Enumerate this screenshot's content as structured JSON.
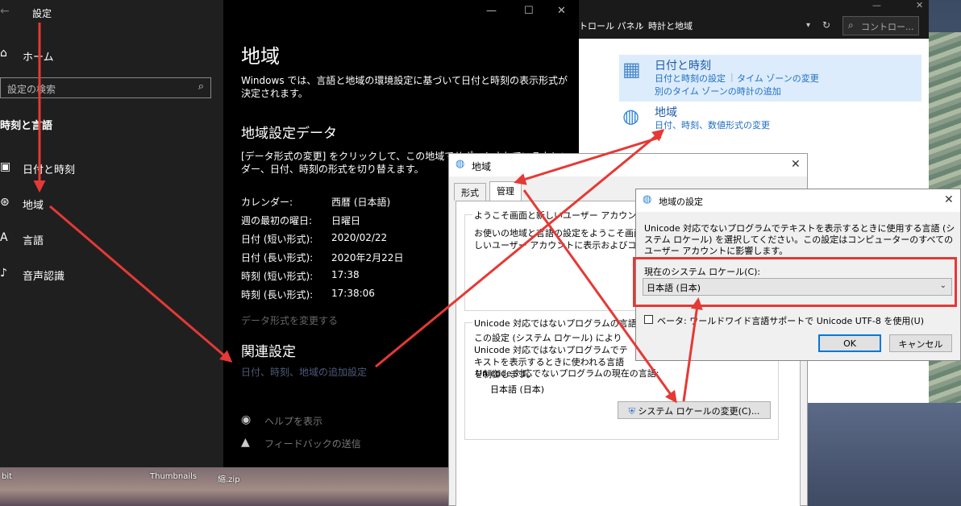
{
  "settings": {
    "app_title": "設定",
    "home": "ホーム",
    "search_placeholder": "設定の検索",
    "section": "時刻と言語",
    "nav": [
      {
        "label": "日付と時刻"
      },
      {
        "label": "地域"
      },
      {
        "label": "言語"
      },
      {
        "label": "音声認識"
      }
    ],
    "page_title": "地域",
    "intro": "Windows では、言語と地域の環境設定に基づいて日付と時刻の表示形式が決定されます。",
    "data_heading": "地域設定データ",
    "data_desc": "[データ形式の変更] をクリックして、この地域でサポートされているカレンダー、日付、時刻の形式を切り替えます。",
    "rows": [
      {
        "key": "カレンダー:",
        "value": "西暦 (日本語)"
      },
      {
        "key": "週の最初の曜日:",
        "value": "日曜日"
      },
      {
        "key": "日付 (短い形式):",
        "value": "2020/02/22"
      },
      {
        "key": "日付 (長い形式):",
        "value": "2020年2月22日"
      },
      {
        "key": "時刻 (短い形式):",
        "value": "17:38"
      },
      {
        "key": "時刻 (長い形式):",
        "value": "17:38:06"
      }
    ],
    "change_format_link": "データ形式を変更する",
    "related_heading": "関連設定",
    "related_link": "日付、時刻、地域の追加設定",
    "help": "ヘルプを表示",
    "feedback": "フィードバックの送信"
  },
  "control_panel": {
    "breadcrumb_1": "トロール パネル",
    "breadcrumb_2": "時計と地域",
    "search_placeholder": "コントロー...",
    "datetime": {
      "title": "日付と時刻",
      "link_1": "日付と時刻の設定",
      "link_2": "タイム ゾーンの変更",
      "link_3": "別のタイム ゾーンの時計の追加"
    },
    "region": {
      "title": "地域",
      "link": "日付、時刻、数値形式の変更"
    }
  },
  "region_dialog": {
    "title": "地域",
    "tabs": [
      "形式",
      "管理"
    ],
    "welcome_group": "ようこそ画面と新しいユーザー アカウント",
    "welcome_text": "お使いの地域と言語の設定をようこそ画面、システム アカウント、および新しいユーザー アカウントに表示およびコピーします。",
    "unicode_group": "Unicode 対応ではないプログラムの言語",
    "unicode_text": "この設定 (システム ロケール) により Unicode 対応ではないプログラムでテキストを表示するときに使われる言語を制御します。",
    "current_label": "Unicode 対応でないプログラムの現在の言語:",
    "current_value": "日本語 (日本)",
    "change_button": "システム ロケールの変更(C)..."
  },
  "locale_dialog": {
    "title": "地域の設定",
    "description": "Unicode 対応でないプログラムでテキストを表示するときに使用する言語 (システム ロケール) を選択してください。この設定はコンピューターのすべてのユーザー アカウントに影響します。",
    "current_label": "現在のシステム ロケール(C):",
    "current_value": "日本語 (日本)",
    "beta_checkbox": "ベータ: ワールドワイド言語サポートで Unicode UTF-8 を使用(U)",
    "ok": "OK",
    "cancel": "キャンセル"
  },
  "desktop": {
    "labels": [
      "bit",
      "Thumbnails",
      "縮.zip"
    ]
  },
  "colors": {
    "arrow": "#e53935",
    "link_blue": "#1e6fc2",
    "highlight": "#dcecfc"
  }
}
